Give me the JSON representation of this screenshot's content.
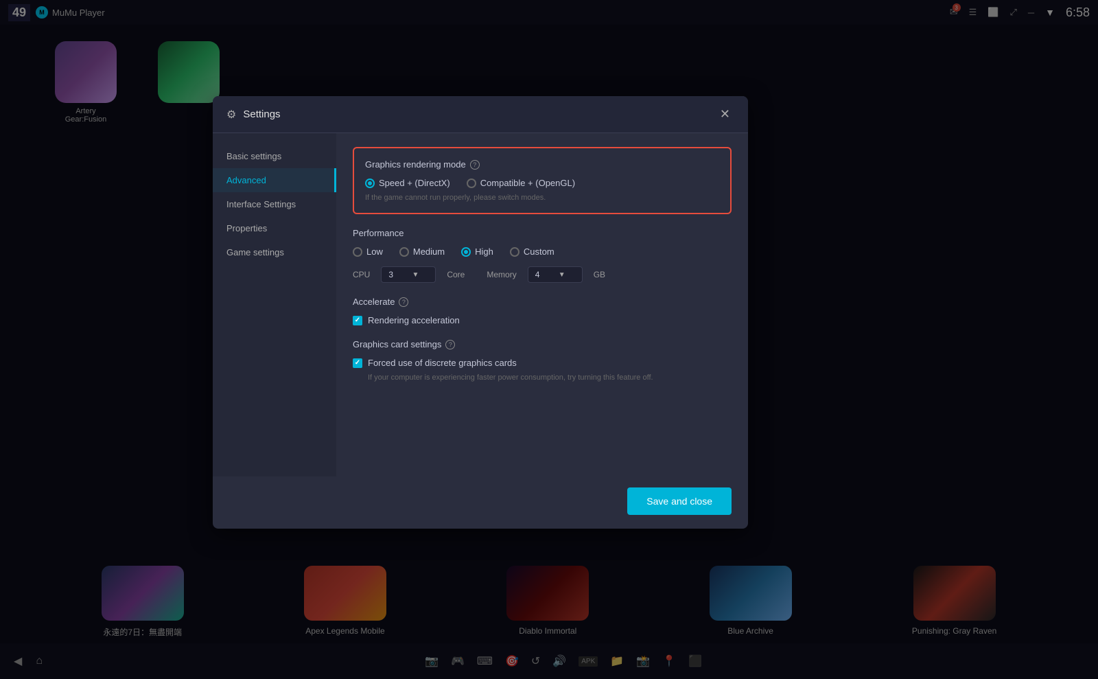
{
  "app": {
    "title": "MuMu Player",
    "badge": "49",
    "time": "6:58"
  },
  "topbar": {
    "logo": "MuMu Player",
    "tray_badge": "3"
  },
  "sidebar": {
    "items": [
      {
        "id": "basic",
        "label": "Basic settings"
      },
      {
        "id": "advanced",
        "label": "Advanced",
        "active": true
      },
      {
        "id": "interface",
        "label": "Interface Settings"
      },
      {
        "id": "properties",
        "label": "Properties"
      },
      {
        "id": "game",
        "label": "Game settings"
      }
    ]
  },
  "settings": {
    "title": "Settings",
    "sections": {
      "rendering_mode": {
        "title": "Graphics rendering mode",
        "options": [
          {
            "id": "speed",
            "label": "Speed + (DirectX)",
            "selected": true
          },
          {
            "id": "compatible",
            "label": "Compatible + (OpenGL)",
            "selected": false
          }
        ],
        "hint": "If the game cannot run properly, please switch modes."
      },
      "performance": {
        "title": "Performance",
        "options": [
          {
            "id": "low",
            "label": "Low",
            "selected": false
          },
          {
            "id": "medium",
            "label": "Medium",
            "selected": false
          },
          {
            "id": "high",
            "label": "High",
            "selected": true
          },
          {
            "id": "custom",
            "label": "Custom",
            "selected": false
          }
        ],
        "cpu_label": "CPU",
        "cpu_value": "3",
        "core_label": "Core",
        "memory_label": "Memory",
        "memory_value": "4",
        "gb_label": "GB"
      },
      "accelerate": {
        "title": "Accelerate",
        "rendering_acceleration_label": "Rendering acceleration",
        "rendering_acceleration_checked": true
      },
      "graphics_card": {
        "title": "Graphics card settings",
        "discrete_label": "Forced use of discrete graphics cards",
        "discrete_checked": true,
        "hint": "If your computer is experiencing faster power consumption, try turning this feature off."
      }
    },
    "footer": {
      "save_close": "Save and close"
    }
  },
  "games": {
    "top": [
      {
        "name": "Artery Gear:Fusion",
        "thumb_class": "game-thumb-artery"
      },
      {
        "name": "",
        "thumb_class": "game-thumb-apex"
      }
    ],
    "bottom": [
      {
        "name": "永遠的7日：無盡開端",
        "thumb_class": "thumb-eternal"
      },
      {
        "name": "Apex Legends Mobile",
        "thumb_class": "thumb-apex"
      },
      {
        "name": "Diablo Immortal",
        "thumb_class": "thumb-diablo"
      },
      {
        "name": "Blue Archive",
        "thumb_class": "thumb-blue"
      },
      {
        "name": "Punishing: Gray Raven",
        "thumb_class": "thumb-punishing"
      }
    ]
  },
  "taskbar": {
    "icons": [
      "⏪",
      "🏠",
      "📷",
      "🎮",
      "⌨",
      "🎯",
      "🔊",
      "APK",
      "📁",
      "📸",
      "📍",
      "⬛"
    ]
  }
}
